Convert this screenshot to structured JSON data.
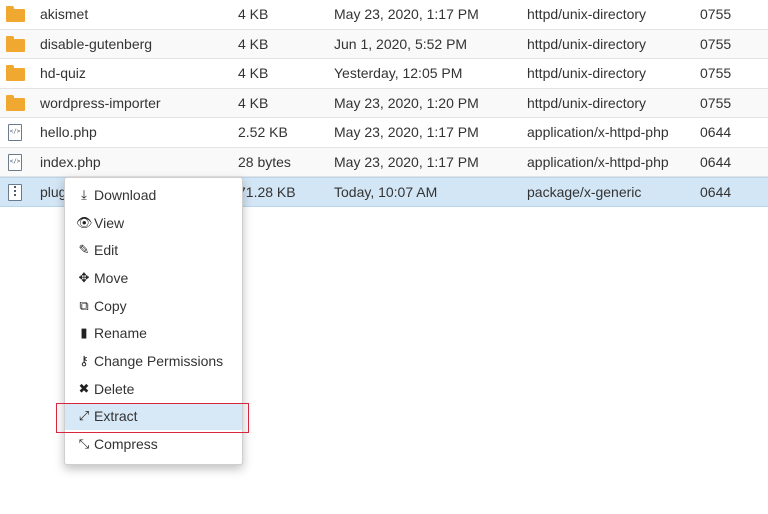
{
  "files": [
    {
      "icon": "folder-icon",
      "name": "akismet",
      "size": "4 KB",
      "modified": "May 23, 2020, 1:17 PM",
      "type": "httpd/unix-directory",
      "perms": "0755"
    },
    {
      "icon": "folder-icon",
      "name": "disable-gutenberg",
      "size": "4 KB",
      "modified": "Jun 1, 2020, 5:52 PM",
      "type": "httpd/unix-directory",
      "perms": "0755"
    },
    {
      "icon": "folder-icon",
      "name": "hd-quiz",
      "size": "4 KB",
      "modified": "Yesterday, 12:05 PM",
      "type": "httpd/unix-directory",
      "perms": "0755"
    },
    {
      "icon": "folder-icon",
      "name": "wordpress-importer",
      "size": "4 KB",
      "modified": "May 23, 2020, 1:20 PM",
      "type": "httpd/unix-directory",
      "perms": "0755"
    },
    {
      "icon": "php-file-icon",
      "name": "hello.php",
      "size": "2.52 KB",
      "modified": "May 23, 2020, 1:17 PM",
      "type": "application/x-httpd-php",
      "perms": "0644"
    },
    {
      "icon": "php-file-icon",
      "name": "index.php",
      "size": "28 bytes",
      "modified": "May 23, 2020, 1:17 PM",
      "type": "application/x-httpd-php",
      "perms": "0644"
    },
    {
      "icon": "zip-file-icon",
      "name": "plug",
      "size": "71.28 KB",
      "modified": "Today, 10:07 AM",
      "type": "package/x-generic",
      "perms": "0644"
    }
  ],
  "context_menu": {
    "items": [
      {
        "icon": "download-icon",
        "glyph": "⤓",
        "label": "Download"
      },
      {
        "icon": "eye-icon",
        "glyph": "👁",
        "label": "View"
      },
      {
        "icon": "pencil-icon",
        "glyph": "✎",
        "label": "Edit"
      },
      {
        "icon": "move-icon",
        "glyph": "✥",
        "label": "Move"
      },
      {
        "icon": "copy-icon",
        "glyph": "⧉",
        "label": "Copy"
      },
      {
        "icon": "file-icon",
        "glyph": "▮",
        "label": "Rename"
      },
      {
        "icon": "key-icon",
        "glyph": "⚷",
        "label": "Change Permissions"
      },
      {
        "icon": "close-icon",
        "glyph": "✖",
        "label": "Delete"
      },
      {
        "icon": "expand-icon",
        "glyph": "⤢",
        "label": "Extract"
      },
      {
        "icon": "compress-icon",
        "glyph": "⤡",
        "label": "Compress"
      }
    ],
    "highlighted": "Extract"
  },
  "colors": {
    "folder": "#f0a830",
    "selected_row": "#d3e6f5",
    "highlight_outline": "#d7263d"
  }
}
